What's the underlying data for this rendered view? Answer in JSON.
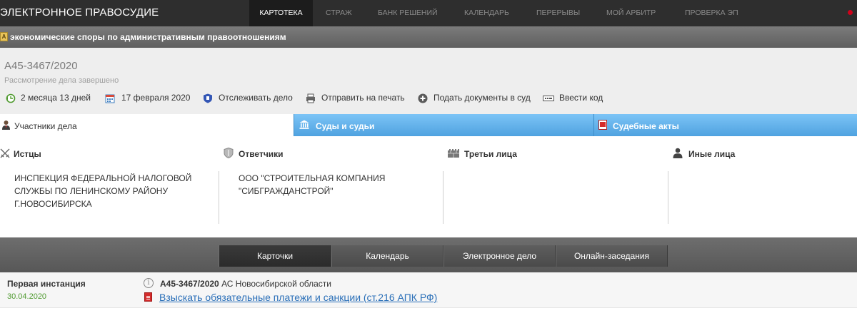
{
  "nav": {
    "brand": "ЭЛЕКТРОННОЕ ПРАВОСУДИЕ",
    "items": [
      {
        "label": "КАРТОТЕКА",
        "active": true
      },
      {
        "label": "СТРАЖ"
      },
      {
        "label": "БАНК РЕШЕНИЙ"
      },
      {
        "label": "КАЛЕНДАРЬ"
      },
      {
        "label": "ПЕРЕРЫВЫ"
      },
      {
        "label": "МОЙ АРБИТР"
      },
      {
        "label": "ПРОВЕРКА ЭП"
      }
    ]
  },
  "category": {
    "icon": "document-category-icon",
    "text": "экономические споры по административным правоотношениям"
  },
  "case": {
    "number": "А45-3467/2020",
    "status": "Рассмотрение дела завершено",
    "actions": [
      {
        "icon": "duration-clock-icon",
        "label": "2 месяца 13 дней"
      },
      {
        "icon": "calendar-icon",
        "label": "17 февраля 2020"
      },
      {
        "icon": "shield-track-icon",
        "label": "Отслеживать дело"
      },
      {
        "icon": "printer-icon",
        "label": "Отправить на печать"
      },
      {
        "icon": "plus-circle-icon",
        "label": "Подать документы в суд"
      },
      {
        "icon": "code-input-icon",
        "label": "Ввести код"
      }
    ]
  },
  "participant_tabs": [
    {
      "icon": "person-icon",
      "label": "Участники дела",
      "active": true
    },
    {
      "icon": "courthouse-icon",
      "label": "Суды и судьи"
    },
    {
      "icon": "pdf-acts-icon",
      "label": "Судебные акты"
    }
  ],
  "parties": {
    "plaintiffs": {
      "icon": "crossed-swords-icon",
      "title": "Истцы",
      "names": [
        "ИНСПЕКЦИЯ ФЕДЕРАЛЬНОЙ НАЛОГОВОЙ СЛУЖБЫ ПО ЛЕНИНСКОМУ РАЙОНУ Г.НОВОСИБИРСКА"
      ]
    },
    "defendants": {
      "icon": "shield-icon",
      "title": "Ответчики",
      "names": [
        "ООО \"СТРОИТЕЛЬНАЯ КОМПАНИЯ \"СИБГРАЖДАНСТРОЙ\""
      ]
    },
    "third": {
      "icon": "castle-wall-icon",
      "title": "Третьи лица",
      "names": []
    },
    "other": {
      "icon": "person-silhouette-icon",
      "title": "Иные лица",
      "names": []
    }
  },
  "bottom_tabs": [
    {
      "label": "Карточки",
      "active": true
    },
    {
      "label": "Календарь"
    },
    {
      "label": "Электронное дело"
    },
    {
      "label": "Онлайн-заседания"
    }
  ],
  "instance": {
    "title": "Первая инстанция",
    "date": "30.04.2020",
    "case_number": "А45-3467/2020",
    "court": " АС Новосибирской области",
    "document_link": "Взыскать обязательные платежи и санкции (ст.216 АПК РФ)"
  }
}
